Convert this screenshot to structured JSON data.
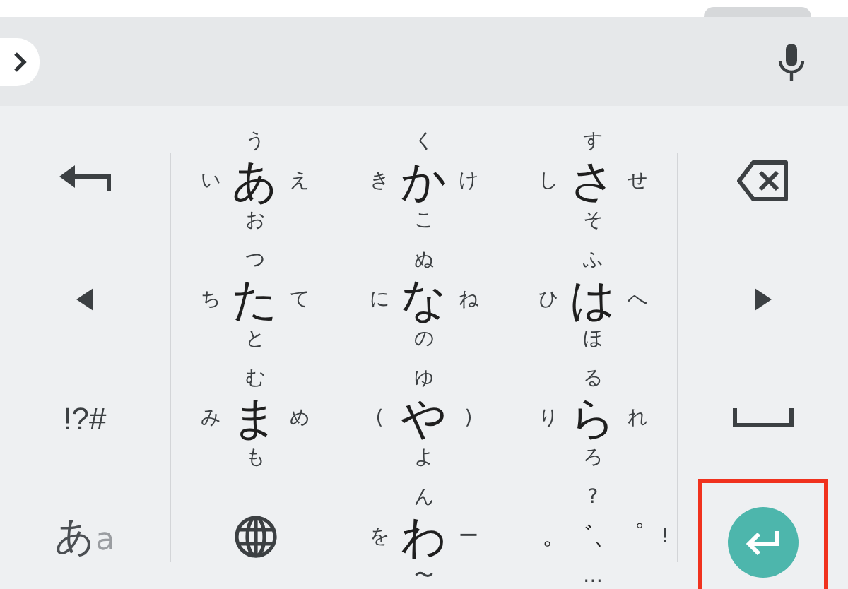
{
  "toolbar": {
    "expanded": false
  },
  "left_keys": [
    {
      "kind": "undo"
    },
    {
      "kind": "cursor_left"
    },
    {
      "kind": "text",
      "label": "!?#"
    },
    {
      "kind": "mode",
      "label": "あ",
      "secondary": "a"
    }
  ],
  "kana_keys": [
    {
      "kind": "flick",
      "main": "あ",
      "up": "う",
      "left": "い",
      "right": "え",
      "down": "お"
    },
    {
      "kind": "flick",
      "main": "か",
      "up": "く",
      "left": "き",
      "right": "け",
      "down": "こ"
    },
    {
      "kind": "flick",
      "main": "さ",
      "up": "す",
      "left": "し",
      "right": "せ",
      "down": "そ"
    },
    {
      "kind": "flick",
      "main": "た",
      "up": "つ",
      "left": "ち",
      "right": "て",
      "down": "と"
    },
    {
      "kind": "flick",
      "main": "な",
      "up": "ぬ",
      "left": "に",
      "right": "ね",
      "down": "の"
    },
    {
      "kind": "flick",
      "main": "は",
      "up": "ふ",
      "left": "ひ",
      "right": "へ",
      "down": "ほ"
    },
    {
      "kind": "flick",
      "main": "ま",
      "up": "む",
      "left": "み",
      "right": "め",
      "down": "も"
    },
    {
      "kind": "flick",
      "main": "や",
      "up": "ゆ",
      "left": "(",
      "right": ")",
      "down": "よ"
    },
    {
      "kind": "flick",
      "main": "ら",
      "up": "る",
      "left": "り",
      "right": "れ",
      "down": "ろ"
    },
    {
      "kind": "globe"
    },
    {
      "kind": "flick",
      "main": "わ",
      "up": "ん",
      "left": "を",
      "right": "ー",
      "down": "〜"
    },
    {
      "kind": "flick",
      "main": "。゛、゜",
      "up": "?",
      "right": "!",
      "down": "…"
    }
  ],
  "right_keys": [
    {
      "kind": "backspace"
    },
    {
      "kind": "cursor_right"
    },
    {
      "kind": "space"
    },
    {
      "kind": "enter",
      "highlighted": true
    }
  ]
}
